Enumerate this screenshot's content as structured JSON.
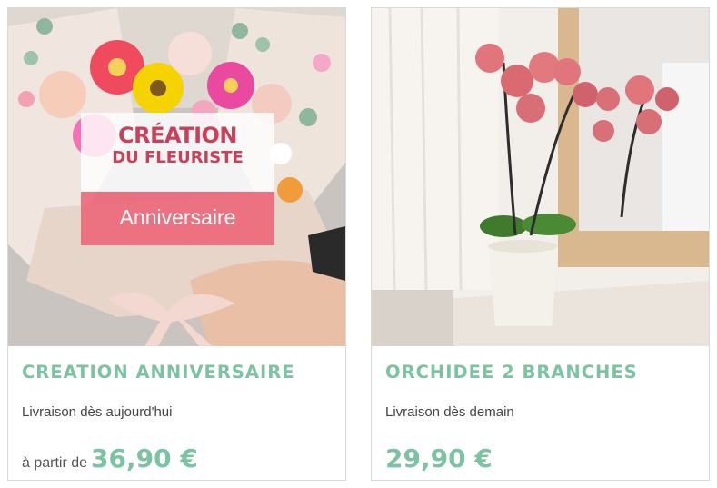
{
  "products": [
    {
      "title": "CREATION ANNIVERSAIRE",
      "delivery": "Livraison dès aujourd'hui",
      "price_prefix": "à partir de",
      "price": "36,90 €",
      "overlay": {
        "line1": "CRÉATION",
        "line2": "DU FLEURISTE",
        "tag": "Anniversaire"
      }
    },
    {
      "title": "ORCHIDEE 2 BRANCHES",
      "delivery": "Livraison dès demain",
      "price": "29,90 €"
    }
  ],
  "colors": {
    "accent": "#7cc3a4",
    "overlay_red": "#c8405a",
    "overlay_pink": "#ec6478"
  }
}
